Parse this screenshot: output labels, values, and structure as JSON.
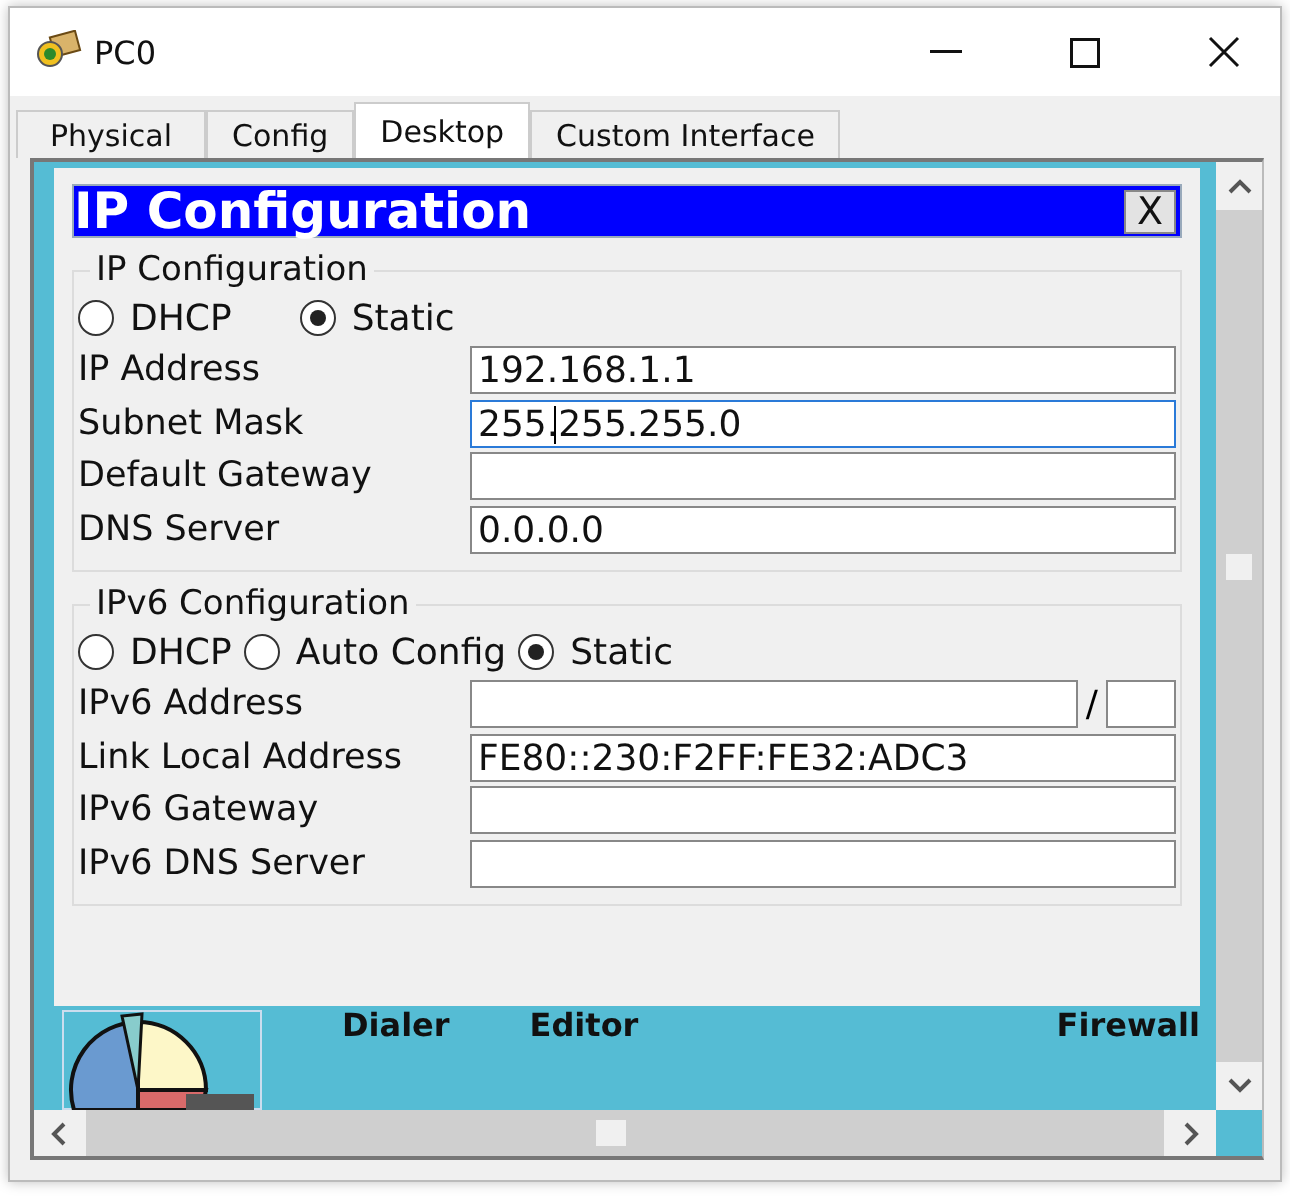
{
  "window": {
    "title": "PC0"
  },
  "tabs": [
    {
      "label": "Physical",
      "selected": false
    },
    {
      "label": "Config",
      "selected": false
    },
    {
      "label": "Desktop",
      "selected": true
    },
    {
      "label": "Custom Interface",
      "selected": false
    }
  ],
  "dialog": {
    "title": "IP Configuration",
    "close": "X",
    "sections": [
      {
        "legend": "IP Configuration",
        "modes": [
          {
            "label": "DHCP",
            "selected": false
          },
          {
            "label": "Static",
            "selected": true
          }
        ],
        "fields": [
          {
            "label": "IP Address",
            "value": "192.168.1.1",
            "focused": false
          },
          {
            "label": "Subnet Mask",
            "value": "255.255.255.0",
            "focused": true
          },
          {
            "label": "Default Gateway",
            "focused": false
          },
          {
            "label": "DNS Server",
            "value": "0.0.0.0",
            "focused": false
          }
        ]
      },
      {
        "legend": "IPv6 Configuration",
        "modes": [
          {
            "label": "DHCP",
            "selected": false
          },
          {
            "label": "Auto Config",
            "selected": false
          },
          {
            "label": "Static",
            "selected": true
          }
        ],
        "fields": [
          {
            "label": "IPv6 Address",
            "focused": false,
            "kind": "prefix",
            "separator": "/"
          },
          {
            "label": "Link Local Address",
            "value": "FE80::230:F2FF:FE32:ADC3",
            "focused": false
          },
          {
            "label": "IPv6 Gateway",
            "focused": false
          },
          {
            "label": "IPv6 DNS Server",
            "focused": false
          }
        ]
      }
    ]
  },
  "desktop_apps": [
    {
      "label": "Dialer"
    },
    {
      "label": "Editor"
    },
    {
      "label": "Firewall"
    }
  ]
}
